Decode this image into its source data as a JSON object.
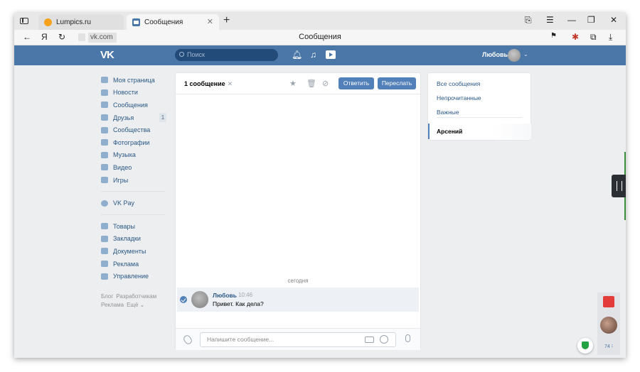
{
  "browser": {
    "tabs": [
      {
        "label": "Lumpics.ru"
      },
      {
        "label": "Сообщения"
      }
    ],
    "new_tab_glyph": "+",
    "address": {
      "domain": "vk.com",
      "page_title": "Сообщения"
    }
  },
  "vk_header": {
    "logo": "VK",
    "search_placeholder": "Поиск",
    "user_name": "Любовь"
  },
  "left_menu": {
    "primary": [
      {
        "label": "Моя страница",
        "icon": "home-icon"
      },
      {
        "label": "Новости",
        "icon": "news-icon"
      },
      {
        "label": "Сообщения",
        "icon": "messages-icon"
      },
      {
        "label": "Друзья",
        "icon": "friends-icon",
        "badge": "1"
      },
      {
        "label": "Сообщества",
        "icon": "communities-icon"
      },
      {
        "label": "Фотографии",
        "icon": "camera-icon"
      },
      {
        "label": "Музыка",
        "icon": "music-icon"
      },
      {
        "label": "Видео",
        "icon": "video-icon"
      },
      {
        "label": "Игры",
        "icon": "gamepad-icon"
      }
    ],
    "pay": {
      "label": "VK Pay",
      "icon": "vkpay-icon"
    },
    "secondary": [
      {
        "label": "Товары",
        "icon": "bag-icon"
      },
      {
        "label": "Закладки",
        "icon": "star-icon"
      },
      {
        "label": "Документы",
        "icon": "document-icon"
      },
      {
        "label": "Реклама",
        "icon": "megaphone-icon"
      },
      {
        "label": "Управление",
        "icon": "gamepad-icon"
      }
    ],
    "footer": [
      "Блог",
      "Разработчикам",
      "Реклама",
      "Ещё ⌄"
    ]
  },
  "dialog": {
    "selected_count": "1 сообщение",
    "close_glyph": "✕",
    "reply_label": "Ответить",
    "forward_label": "Переслать",
    "day_label": "сегодня",
    "message": {
      "author": "Любовь",
      "time": "10:46",
      "text": "Привет. Как дела?"
    },
    "input_placeholder": "Напишите сообщение..."
  },
  "folders": {
    "items": [
      "Все сообщения",
      "Непрочитанные",
      "Важные"
    ],
    "selected_chat": "Арсений"
  },
  "right_widget": {
    "count": "74 ⁝"
  },
  "colors": {
    "vk_blue": "#4a76a8",
    "button_blue": "#5181b8",
    "link_blue": "#2a5885",
    "page_bg": "#edeef0"
  }
}
